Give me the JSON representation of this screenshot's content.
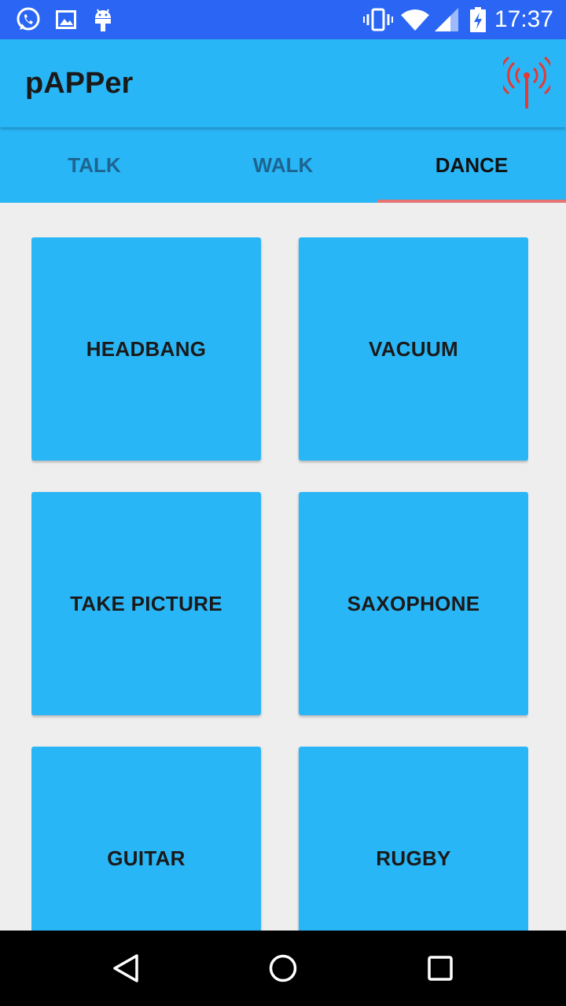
{
  "status_bar": {
    "time": "17:37",
    "icons": [
      "whatsapp-icon",
      "image-icon",
      "android-icon",
      "vibrate-icon",
      "wifi-icon",
      "cell-signal-icon",
      "battery-charging-icon"
    ]
  },
  "app_bar": {
    "title": "pAPPer",
    "action_icon": "antenna-icon",
    "action_icon_color": "#e53935"
  },
  "tabs": [
    {
      "label": "TALK",
      "active": false
    },
    {
      "label": "WALK",
      "active": false
    },
    {
      "label": "DANCE",
      "active": true
    }
  ],
  "buttons": [
    {
      "label": "HEADBANG"
    },
    {
      "label": "VACUUM"
    },
    {
      "label": "TAKE PICTURE"
    },
    {
      "label": "SAXOPHONE"
    },
    {
      "label": "GUITAR"
    },
    {
      "label": "RUGBY"
    }
  ],
  "colors": {
    "status_bar": "#2a66f3",
    "primary": "#29b6f6",
    "tab_indicator": "#e57373",
    "background": "#eeeeee"
  },
  "nav_bar": {
    "icons": [
      "back-icon",
      "home-icon",
      "recents-icon"
    ]
  }
}
